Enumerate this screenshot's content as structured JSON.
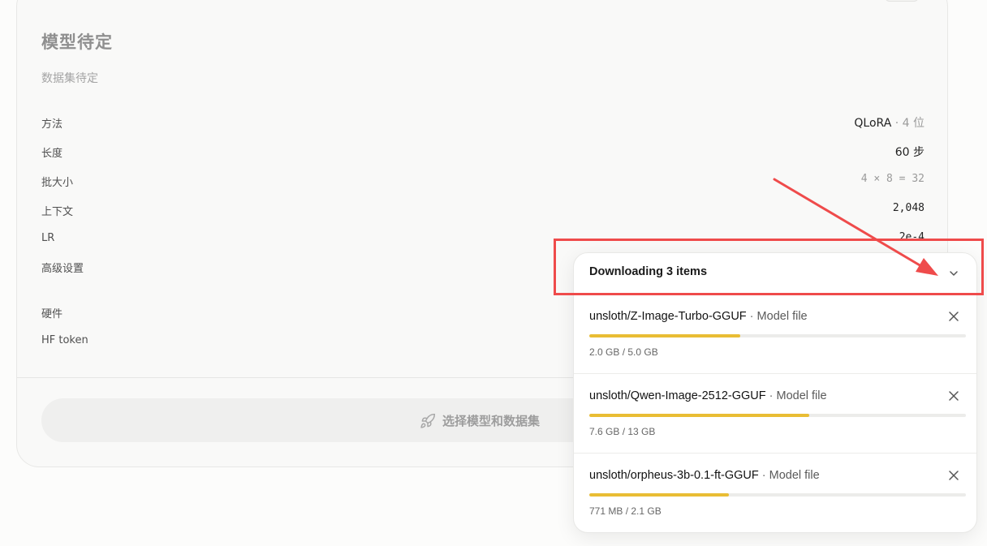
{
  "card": {
    "title": "模型待定",
    "subtitle": "数据集待定",
    "rows": [
      {
        "label": "方法",
        "value_main": "QLoRA",
        "value_muted": " · 4 位"
      },
      {
        "label": "长度",
        "value_main": "60 步",
        "value_muted": ""
      },
      {
        "label": "批大小",
        "value_main": "4 × 8",
        "value_muted": " = 32"
      },
      {
        "label": "上下文",
        "value_main": "2,048",
        "value_muted": ""
      },
      {
        "label": "LR",
        "value_main": "2e-4",
        "value_muted": ""
      },
      {
        "label": "高级设置",
        "value_main": "",
        "value_muted": ""
      },
      {
        "label": "硬件",
        "value_main": "",
        "value_muted": ""
      },
      {
        "label": "HF token",
        "value_main": "",
        "value_muted": ""
      }
    ],
    "cta_label": "选择模型和数据集"
  },
  "downloads": {
    "title": "Downloading 3 items",
    "separator": " · ",
    "items": [
      {
        "name": "unsloth/Z-Image-Turbo-GGUF",
        "kind": "Model file",
        "size": "2.0 GB / 5.0 GB",
        "progress": 0.4
      },
      {
        "name": "unsloth/Qwen-Image-2512-GGUF",
        "kind": "Model file",
        "size": "7.6 GB / 13 GB",
        "progress": 0.585
      },
      {
        "name": "unsloth/orpheus-3b-0.1-ft-GGUF",
        "kind": "Model file",
        "size": "771 MB / 2.1 GB",
        "progress": 0.37
      }
    ]
  },
  "colors": {
    "progress": "#e9bd34",
    "highlight": "#ef4b4b"
  },
  "icons": {
    "collapse": "chevron-down-icon",
    "close": "close-icon",
    "cta": "rocket-icon"
  }
}
